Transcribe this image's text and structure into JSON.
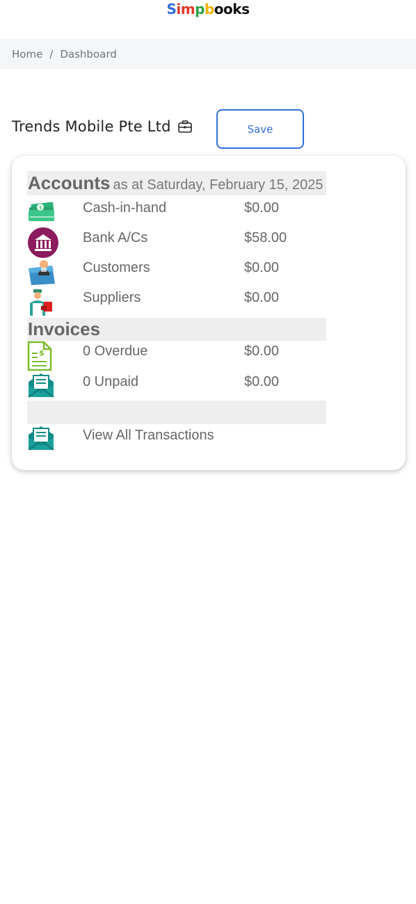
{
  "logo": {
    "parts": [
      "S",
      "im",
      "p",
      "b",
      "oo",
      "ks"
    ]
  },
  "breadcrumb": {
    "home": "Home",
    "separator": "/",
    "current": "Dashboard"
  },
  "company": {
    "name": "Trends Mobile Pte Ltd",
    "icon": "briefcase-icon"
  },
  "actions": {
    "save_label": "Save"
  },
  "accounts": {
    "title": "Accounts",
    "subtitle": "as at Saturday, February 15, 2025",
    "rows": [
      {
        "label": "Cash-in-hand",
        "value": "$0.00",
        "icon": "cash-icon"
      },
      {
        "label": "Bank A/Cs",
        "value": "$58.00",
        "icon": "bank-icon"
      },
      {
        "label": "Customers",
        "value": "$0.00",
        "icon": "customers-icon"
      },
      {
        "label": "Suppliers",
        "value": "$0.00",
        "icon": "suppliers-icon"
      }
    ]
  },
  "invoices": {
    "title": "Invoices",
    "rows": [
      {
        "label": "0 Overdue",
        "value": "$0.00",
        "icon": "invoice-document-icon"
      },
      {
        "label": "0 Unpaid",
        "value": "$0.00",
        "icon": "envelope-letter-icon"
      }
    ]
  },
  "transactions": {
    "label": "View All Transactions",
    "icon": "envelope-letter-icon"
  },
  "colors": {
    "accent": "#2f6fd6",
    "section_bar": "#eeeeee",
    "bank_icon": "#8b1a5f",
    "cash_icon": "#2db37a",
    "envelope_icon": "#138b87",
    "invoice_icon": "#7cbb2f"
  }
}
